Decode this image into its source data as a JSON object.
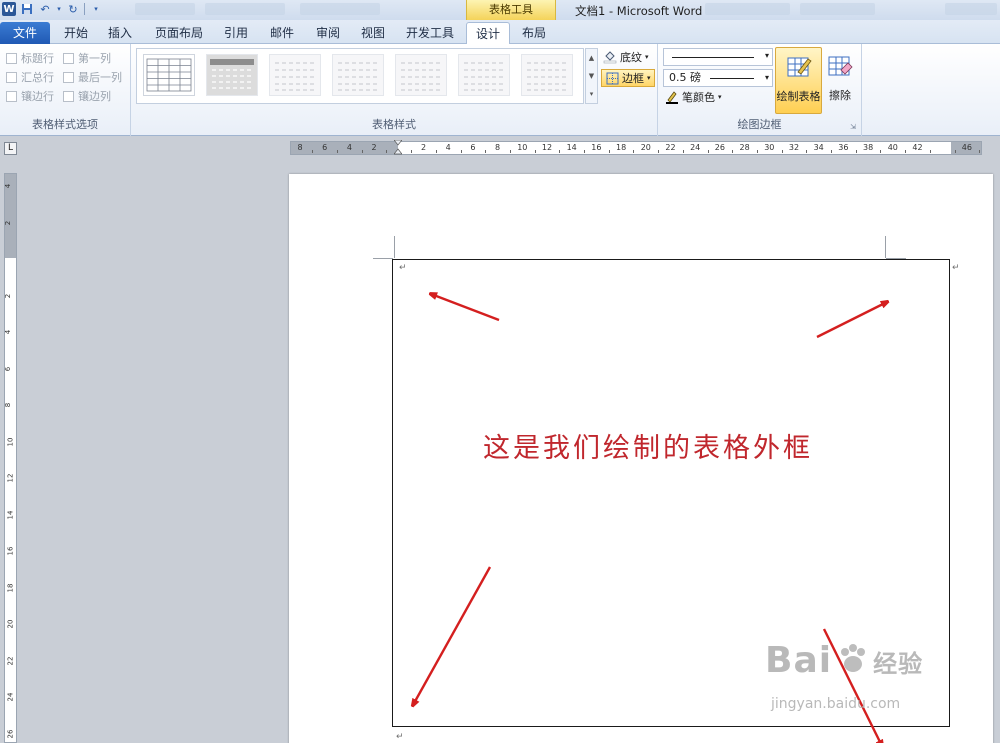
{
  "window": {
    "title": "文档1 - Microsoft Word",
    "context_tab": "表格工具"
  },
  "tabs": [
    {
      "label": "文件"
    },
    {
      "label": "开始"
    },
    {
      "label": "插入"
    },
    {
      "label": "页面布局"
    },
    {
      "label": "引用"
    },
    {
      "label": "邮件"
    },
    {
      "label": "审阅"
    },
    {
      "label": "视图"
    },
    {
      "label": "开发工具"
    },
    {
      "label": "设计"
    },
    {
      "label": "布局"
    }
  ],
  "active_tab": "设计",
  "table_style_options": {
    "group_label": "表格样式选项",
    "items": [
      {
        "label": "标题行",
        "checked": false
      },
      {
        "label": "第一列",
        "checked": false
      },
      {
        "label": "汇总行",
        "checked": false
      },
      {
        "label": "最后一列",
        "checked": false
      },
      {
        "label": "镶边行",
        "checked": false
      },
      {
        "label": "镶边列",
        "checked": false
      }
    ]
  },
  "table_styles": {
    "group_label": "表格样式",
    "shading_label": "底纹",
    "borders_label": "边框"
  },
  "draw_borders": {
    "group_label": "绘图边框",
    "pen_weight": "0.5 磅",
    "pen_color_label": "笔颜色",
    "draw_table_label": "绘制表格",
    "eraser_label": "擦除"
  },
  "ruler": {
    "horizontal": [
      "8",
      "6",
      "4",
      "2",
      "",
      "2",
      "4",
      "6",
      "8",
      "10",
      "12",
      "14",
      "16",
      "18",
      "20",
      "22",
      "24",
      "26",
      "28",
      "30",
      "32",
      "34",
      "36",
      "38",
      "40",
      "42",
      "",
      "46"
    ],
    "vertical": [
      "4",
      "2",
      "",
      "2",
      "4",
      "6",
      "8",
      "10",
      "12",
      "14",
      "16",
      "18",
      "20",
      "22",
      "24",
      "26"
    ]
  },
  "document": {
    "caption": "这是我们绘制的表格外框",
    "para_mark": "↵"
  },
  "watermark": {
    "brand": "Bai",
    "brand2": "经验",
    "url": "jingyan.baidu.com"
  },
  "colors": {
    "accent_file_tab": "#2b5fb8",
    "context_tab": "#f4d35a",
    "caption": "#c0272d",
    "arrow": "#d41f1f"
  }
}
